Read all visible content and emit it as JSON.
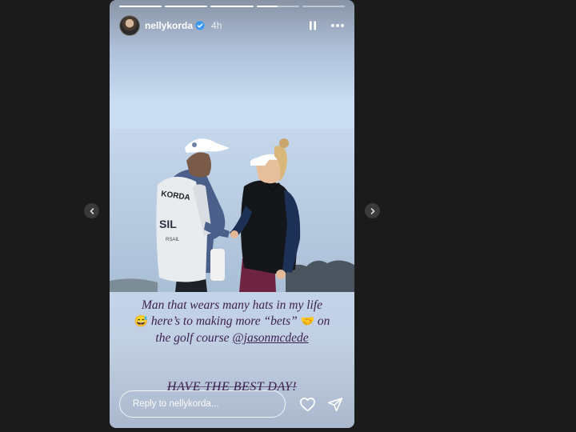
{
  "story": {
    "username": "nellykorda",
    "verified": true,
    "time": "4h",
    "progress": [
      1,
      1,
      1,
      0.5,
      0
    ],
    "caption": {
      "line1": "Man that wears many hats in my life",
      "line2_emoji": "😅",
      "line2_text": " here’s to making more “bets” ",
      "line2_emoji_end": "🤝",
      "line2_tail": " on",
      "line3_text": "the golf course ",
      "mention": "@jasonmcdede"
    },
    "signoff": "HAVE THE BEST DAY!",
    "reply_placeholder": "Reply to nellykorda..."
  },
  "photo": {
    "vest_text": "KORDA",
    "vest_partial": "SIL",
    "vest_small": "RSAIL"
  },
  "icons": {
    "prev": "chevron-left-icon",
    "next": "chevron-right-icon",
    "pause": "pause-icon",
    "more": "more-icon",
    "verified": "verified-badge-icon",
    "heart": "heart-icon",
    "send": "send-icon"
  },
  "colors": {
    "caption": "#3e2150",
    "backdrop": "#1b1b1b",
    "verified": "#3897f0"
  }
}
